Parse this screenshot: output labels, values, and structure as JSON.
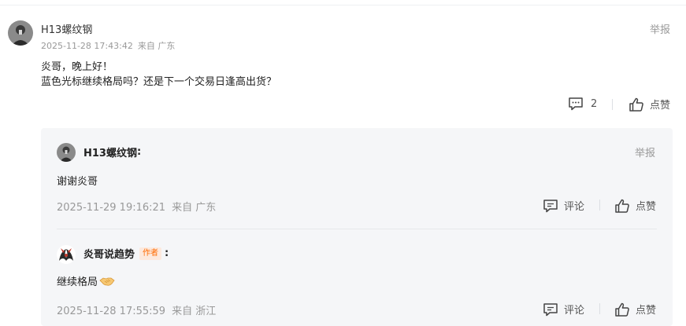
{
  "comment": {
    "username": "H13螺纹钢",
    "timestamp": "2025-11-28 17:43:42",
    "location": "来自 广东",
    "report_label": "举报",
    "lines": [
      "炎哥，晚上好！",
      "蓝色光标继续格局吗？还是下一个交易日逢高出货？"
    ],
    "reply_count": "2",
    "like_label": "点赞"
  },
  "replies": [
    {
      "username": "H13螺纹钢",
      "colon": ":",
      "report_label": "举报",
      "text": "谢谢炎哥",
      "timestamp": "2025-11-29 19:16:21",
      "location": "来自 广东",
      "comment_label": "评论",
      "like_label": "点赞"
    },
    {
      "username": "炎哥说趋势",
      "author_tag": "作者",
      "colon": ":",
      "text": "继续格局",
      "emoji": "handshake-emoji",
      "timestamp": "2025-11-28 17:55:59",
      "location": "来自 浙江",
      "comment_label": "评论",
      "like_label": "点赞"
    }
  ],
  "colors": {
    "author_tag_text": "#ff6a00",
    "author_tag_bg": "#fde9dd",
    "reply_bg": "#f5f6f8",
    "meta_text": "#999999"
  },
  "icons": [
    "comment-icon",
    "thumbs-up-icon",
    "handshake-emoji"
  ]
}
